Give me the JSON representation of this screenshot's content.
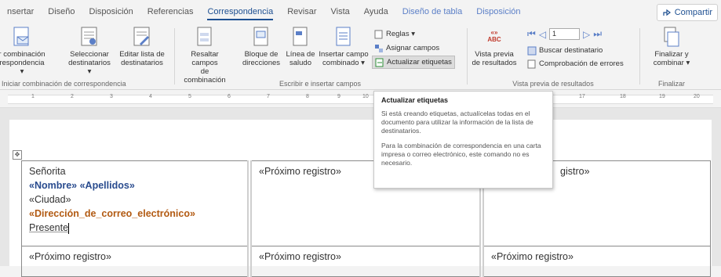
{
  "tabs": {
    "items": [
      "nsertar",
      "Diseño",
      "Disposición",
      "Referencias",
      "Correspondencia",
      "Revisar",
      "Vista",
      "Ayuda"
    ],
    "contextual": [
      "Diseño de tabla",
      "Disposición"
    ],
    "active": "Correspondencia",
    "share_label": "Compartir"
  },
  "ribbon": {
    "group_start": {
      "label": "Iniciar combinación de correspondencia",
      "buttons": [
        "r combinación\nrespondencia ▾",
        "Seleccionar\ndestinatarios ▾",
        "Editar lista de\ndestinatarios"
      ]
    },
    "group_write": {
      "label": "Escribir e insertar campos",
      "buttons": [
        "Resaltar campos\nde combinación",
        "Bloque de\ndirecciones",
        "Línea de\nsaludo",
        "Insertar campo\ncombinado ▾"
      ],
      "small": [
        "Reglas ▾",
        "Asignar campos",
        "Actualizar etiquetas"
      ]
    },
    "group_preview": {
      "label": "Vista previa de resultados",
      "preview_button": "Vista previa\nde resultados",
      "preview_icon_text": "«»\nABC",
      "record_value": "1",
      "small": [
        "Buscar destinatario",
        "Comprobación de errores"
      ]
    },
    "group_finish": {
      "label": "Finalizar",
      "button": "Finalizar y\ncombinar ▾"
    }
  },
  "ruler": {
    "numbers": [
      "1",
      "2",
      "3",
      "4",
      "5",
      "6",
      "7",
      "8",
      "9",
      "10",
      "17",
      "18",
      "19",
      "20"
    ],
    "end_label": "20"
  },
  "tooltip": {
    "title": "Actualizar etiquetas",
    "para1": "Si está creando etiquetas, actualícelas todas en el documento para utilizar la información de la lista de destinatarios.",
    "para2": "Para la combinación de correspondencia en una carta impresa o correo electrónico, este comando no es necesario."
  },
  "table": {
    "cell1": {
      "line1": "Señorita",
      "line2": "«Nombre» «Apellidos»",
      "line3": "«Ciudad»",
      "line4": "«Dirección_de_correo_electrónico»",
      "line5": "Presente"
    },
    "next_record": "«Próximo registro»",
    "next_record_partial": "gistro»"
  },
  "colors": {
    "accent": "#1d4f91",
    "field_blue": "#2a4c8f",
    "field_orange": "#b25a12"
  }
}
